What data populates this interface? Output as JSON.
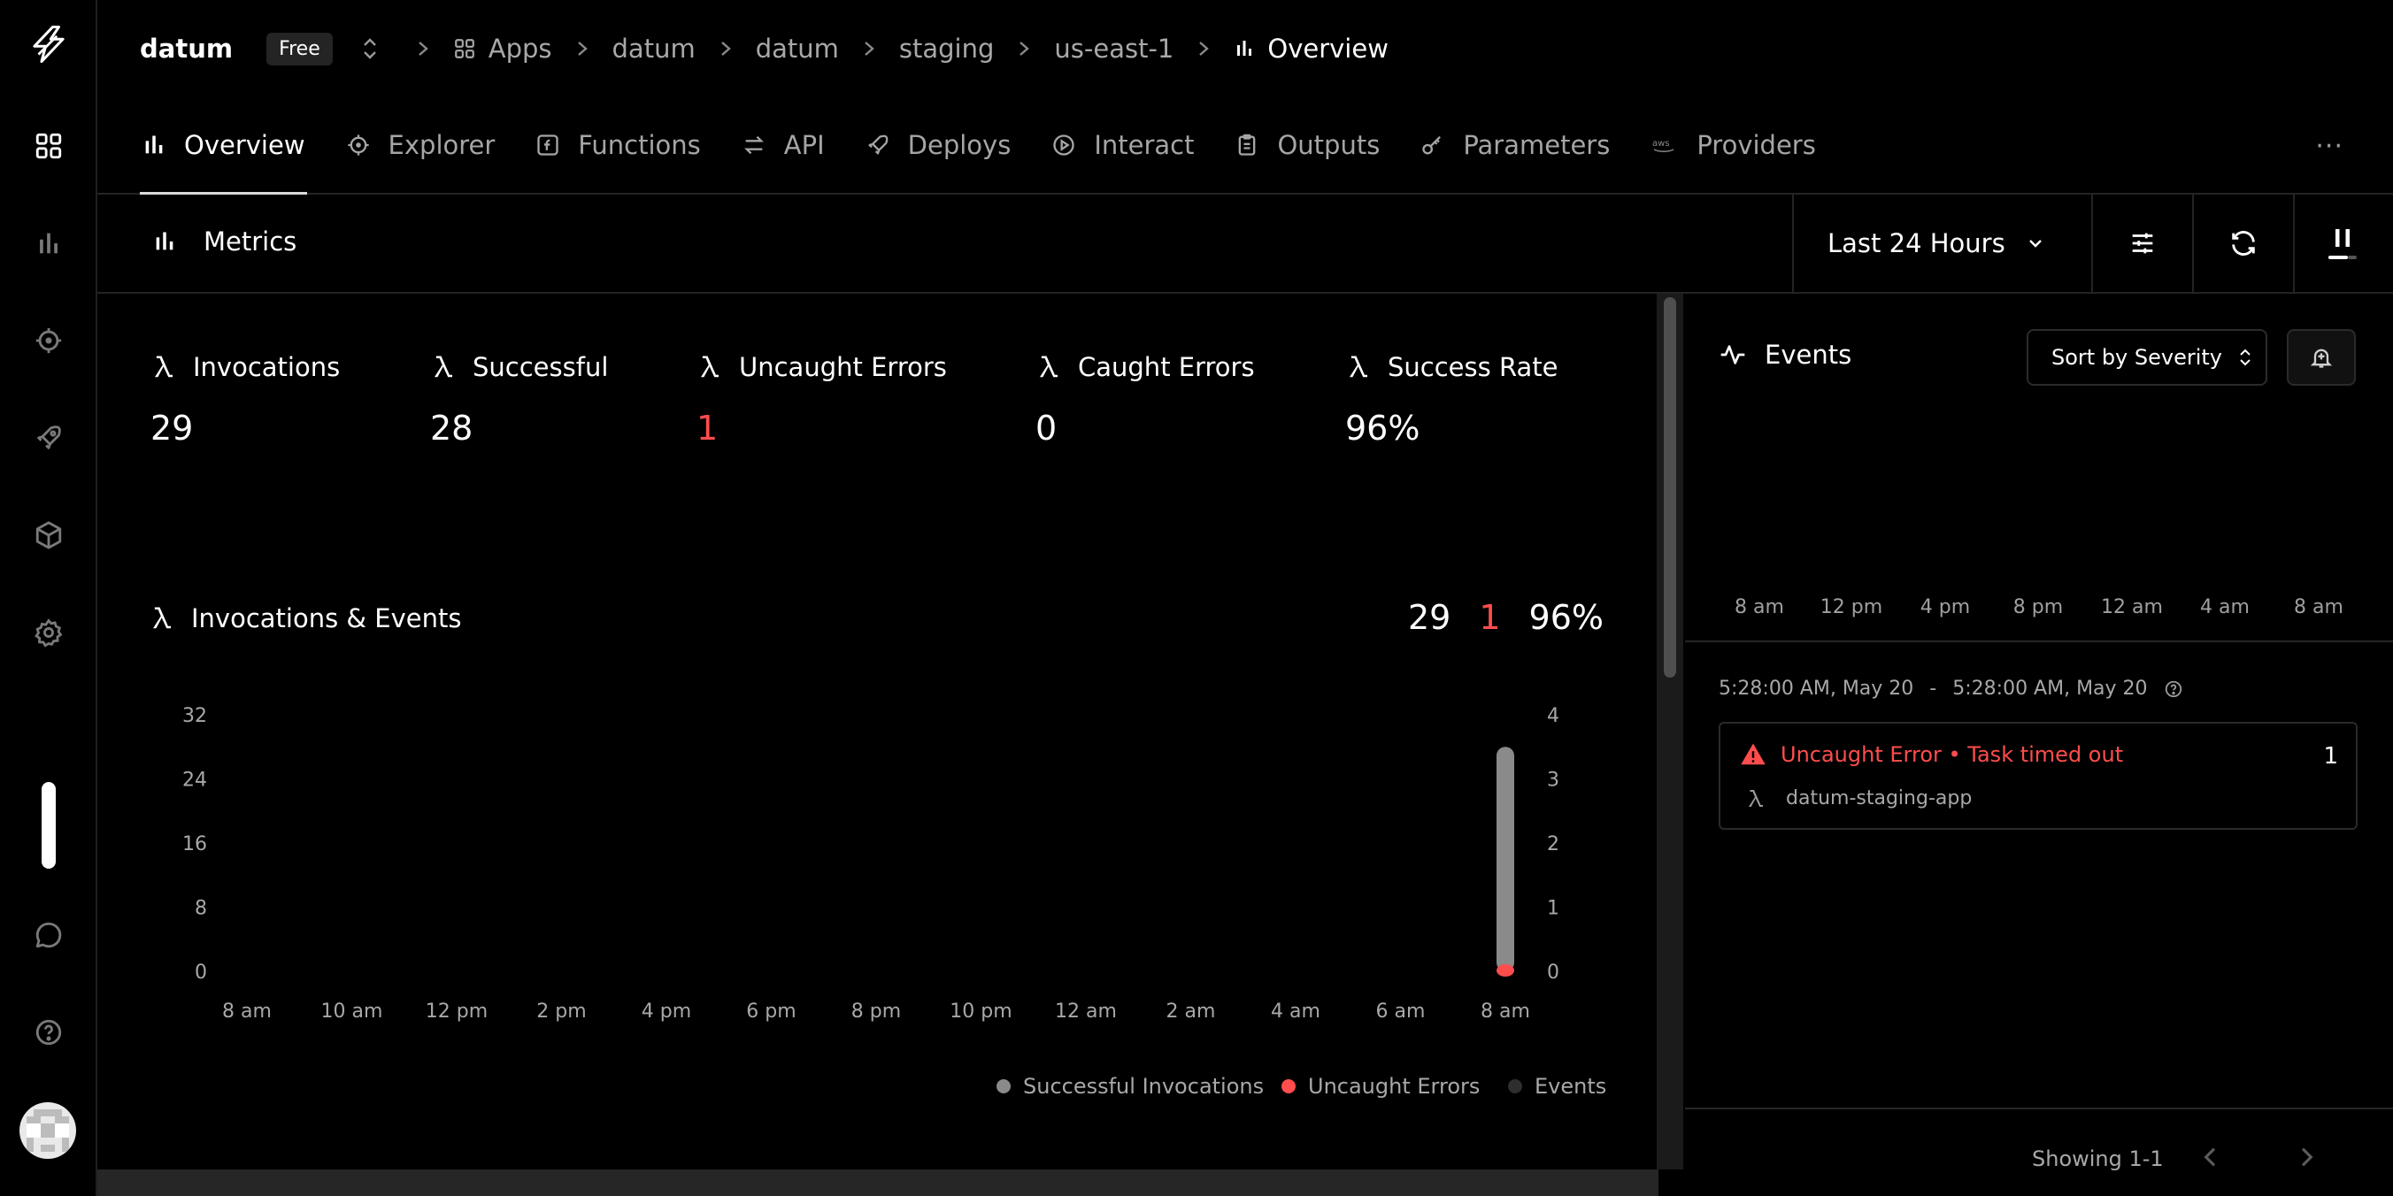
{
  "header": {
    "org": "datum",
    "plan_badge": "Free",
    "breadcrumbs": [
      "Apps",
      "datum",
      "datum",
      "staging",
      "us-east-1",
      "Overview"
    ]
  },
  "tabs": [
    {
      "label": "Overview",
      "icon": "bar-chart-icon",
      "active": true
    },
    {
      "label": "Explorer",
      "icon": "crosshair-icon"
    },
    {
      "label": "Functions",
      "icon": "function-icon"
    },
    {
      "label": "API",
      "icon": "arrows-icon"
    },
    {
      "label": "Deploys",
      "icon": "rocket-icon"
    },
    {
      "label": "Interact",
      "icon": "play-circle-icon"
    },
    {
      "label": "Outputs",
      "icon": "clipboard-icon"
    },
    {
      "label": "Parameters",
      "icon": "key-icon"
    },
    {
      "label": "Providers",
      "icon": "aws-icon"
    }
  ],
  "more_label": "···",
  "metrics": {
    "title": "Metrics",
    "time_range": "Last 24 Hours"
  },
  "kpis": [
    {
      "label": "Invocations",
      "value": "29"
    },
    {
      "label": "Successful",
      "value": "28"
    },
    {
      "label": "Uncaught Errors",
      "value": "1"
    },
    {
      "label": "Caught Errors",
      "value": "0"
    },
    {
      "label": "Success Rate",
      "value": "96%"
    }
  ],
  "invocations_events": {
    "title": "Invocations & Events",
    "total": "29",
    "errors": "1",
    "rate": "96%"
  },
  "chart_data": {
    "type": "bar",
    "title": "Invocations & Events",
    "x_ticks": [
      "8 am",
      "10 am",
      "12 pm",
      "2 pm",
      "4 pm",
      "6 pm",
      "8 pm",
      "10 pm",
      "12 am",
      "2 am",
      "4 am",
      "6 am",
      "8 am"
    ],
    "y_left_ticks": [
      32,
      24,
      16,
      8,
      0
    ],
    "y_right_ticks": [
      4,
      3,
      2,
      1,
      0
    ],
    "ylim_left": [
      0,
      32
    ],
    "ylim_right": [
      0,
      4
    ],
    "series": [
      {
        "name": "Successful Invocations",
        "color": "#8a8a8a",
        "values": [
          0,
          0,
          0,
          0,
          0,
          0,
          0,
          0,
          0,
          0,
          0,
          0,
          28
        ]
      },
      {
        "name": "Uncaught Errors",
        "color": "#ff4d4d",
        "values": [
          0,
          0,
          0,
          0,
          0,
          0,
          0,
          0,
          0,
          0,
          0,
          0,
          1
        ]
      },
      {
        "name": "Events",
        "color": "#2e2e2e",
        "values": [
          0,
          0,
          0,
          0,
          0,
          0,
          0,
          0,
          0,
          0,
          0,
          0,
          0
        ]
      }
    ]
  },
  "events": {
    "title": "Events",
    "sort_label": "Sort by Severity",
    "axis_ticks": [
      "8 am",
      "12 pm",
      "4 pm",
      "8 pm",
      "12 am",
      "4 am",
      "8 am"
    ],
    "range_start": "5:28:00 AM, May 20",
    "range_sep": "-",
    "range_end": "5:28:00 AM, May 20",
    "items": [
      {
        "title": "Uncaught Error • Task timed out",
        "count": "1",
        "source": "datum-staging-app"
      }
    ],
    "showing": "Showing 1-1"
  }
}
